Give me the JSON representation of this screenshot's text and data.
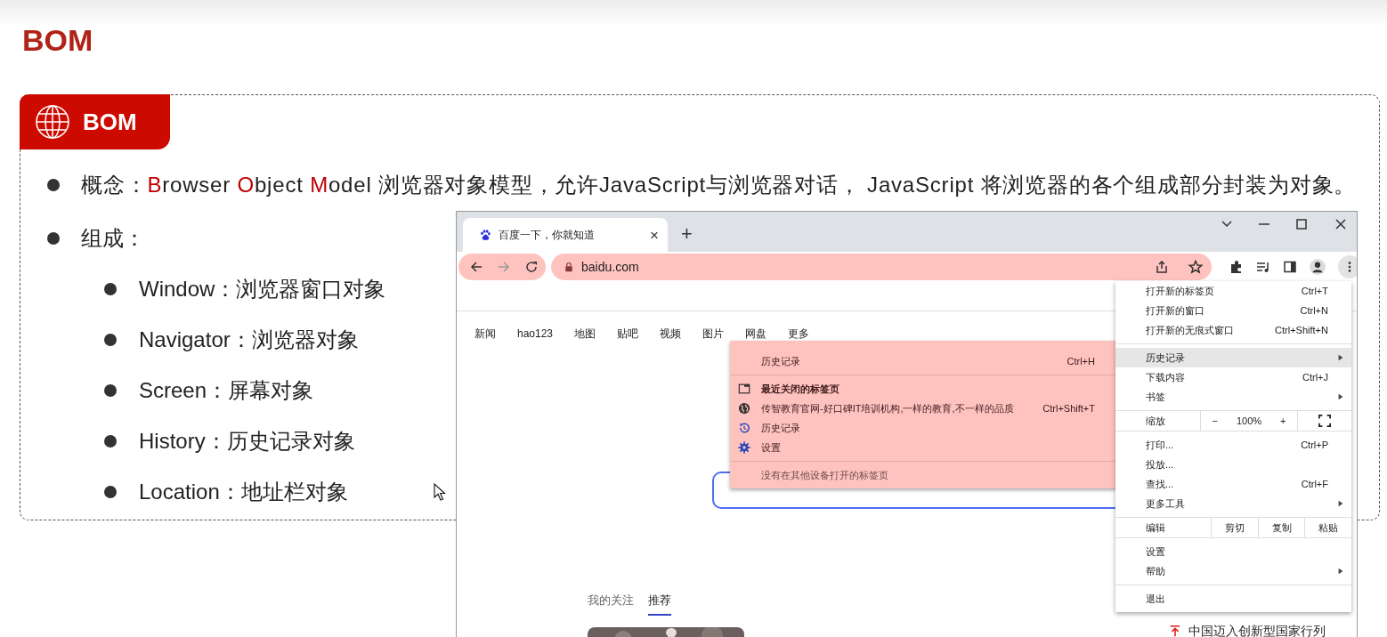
{
  "title": "BOM",
  "card": {
    "label": "BOM"
  },
  "concept": {
    "parts": [
      {
        "text": "概念：",
        "highlight": false
      },
      {
        "text": "B",
        "highlight": true
      },
      {
        "text": "rowser ",
        "highlight": false
      },
      {
        "text": "O",
        "highlight": true
      },
      {
        "text": "bject ",
        "highlight": false
      },
      {
        "text": "M",
        "highlight": true
      },
      {
        "text": "odel  浏览器对象模型，允许JavaScript与浏览器对话， JavaScript 将浏览器的各个组成部分封装为对象。",
        "highlight": false
      }
    ]
  },
  "composition": {
    "label": "组成：",
    "items": [
      "Window：浏览器窗口对象",
      "Navigator：浏览器对象",
      "Screen：屏幕对象",
      "History：历史记录对象",
      "Location：地址栏对象"
    ]
  },
  "browser": {
    "tab": {
      "title": "百度一下，你就知道",
      "close": "×"
    },
    "new_tab": "+",
    "address": "baidu.com",
    "nav_links": [
      "新闻",
      "hao123",
      "地图",
      "贴吧",
      "视频",
      "图片",
      "网盘",
      "更多"
    ],
    "feed_tabs": [
      {
        "label": "我的关注",
        "selected": false
      },
      {
        "label": "推荐",
        "selected": true
      }
    ],
    "hot_item": "中国迈入创新型国家行列",
    "history_menu": {
      "items": [
        {
          "kind": "item",
          "label": "历史记录",
          "shortcut": "Ctrl+H"
        },
        {
          "kind": "divider"
        },
        {
          "kind": "heading",
          "label": "最近关闭的标签页"
        },
        {
          "kind": "page",
          "label": "传智教育官网-好口碑IT培训机构,一样的教育,不一样的品质",
          "shortcut": "Ctrl+Shift+T"
        },
        {
          "kind": "history",
          "label": "历史记录"
        },
        {
          "kind": "settings",
          "label": "设置"
        },
        {
          "kind": "divider"
        },
        {
          "kind": "note",
          "label": "没有在其他设备打开的标签页"
        }
      ]
    },
    "main_menu": {
      "items": [
        {
          "kind": "item",
          "label": "打开新的标签页",
          "shortcut": "Ctrl+T",
          "selected": false,
          "submenu": false
        },
        {
          "kind": "item",
          "label": "打开新的窗口",
          "shortcut": "Ctrl+N",
          "selected": false,
          "submenu": false
        },
        {
          "kind": "item",
          "label": "打开新的无痕式窗口",
          "shortcut": "Ctrl+Shift+N",
          "selected": false,
          "submenu": false
        },
        {
          "kind": "divider"
        },
        {
          "kind": "item",
          "label": "历史记录",
          "selected": true,
          "submenu": true
        },
        {
          "kind": "item",
          "label": "下载内容",
          "shortcut": "Ctrl+J",
          "selected": false,
          "submenu": false
        },
        {
          "kind": "item",
          "label": "书签",
          "selected": false,
          "submenu": true
        },
        {
          "kind": "divider"
        },
        {
          "kind": "zoom",
          "label": "缩放",
          "minus": "−",
          "value": "100%",
          "plus": "+"
        },
        {
          "kind": "divider"
        },
        {
          "kind": "item",
          "label": "打印...",
          "shortcut": "Ctrl+P",
          "selected": false,
          "submenu": false
        },
        {
          "kind": "item",
          "label": "投放...",
          "selected": false,
          "submenu": false
        },
        {
          "kind": "item",
          "label": "查找...",
          "shortcut": "Ctrl+F",
          "selected": false,
          "submenu": false
        },
        {
          "kind": "item",
          "label": "更多工具",
          "selected": false,
          "submenu": true
        },
        {
          "kind": "divider"
        },
        {
          "kind": "edit",
          "label": "编辑",
          "actions": [
            "剪切",
            "复制",
            "粘贴"
          ]
        },
        {
          "kind": "divider"
        },
        {
          "kind": "item",
          "label": "设置",
          "selected": false,
          "submenu": false
        },
        {
          "kind": "item",
          "label": "帮助",
          "selected": false,
          "submenu": true
        },
        {
          "kind": "divider"
        },
        {
          "kind": "item",
          "label": "退出",
          "selected": false,
          "submenu": false
        }
      ]
    }
  }
}
